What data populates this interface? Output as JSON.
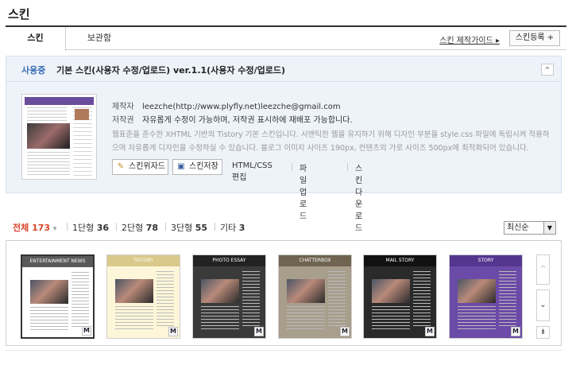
{
  "page": {
    "title": "스킨"
  },
  "tabs": [
    {
      "label": "스킨"
    },
    {
      "label": "보관함"
    }
  ],
  "header_links": {
    "guide": "스킨 제작가이드 ▸",
    "register": "스킨등록 +"
  },
  "current_skin": {
    "badge": "사용중",
    "name": "기본 스킨(사용자 수정/업로드) ver.1.1(사용자 수정/업로드)",
    "author_label": "제작자",
    "author_value": "leezche(http://www.plyfly.net)leezche@gmail.com",
    "license_label": "저작권",
    "license_value": "자유롭게 수정이 가능하며, 저작권 표시하에 재배포 가능합니다.",
    "description_line1": "웹표준을 준수한 XHTML 기반의 Tistory 기본 스킨입니다. 시맨틱한 웹을 유지하기 위해 디자인 부분을 style.css 파일에 독립시켜 적용하였",
    "description_line2": "으며 자유롭게 디자인을 수정하실 수 있습니다. 블로그 이미지 사이즈 190px, 컨텐츠의 가로 사이즈 500px에 최적화되어 있습니다.",
    "collapse_icon": "^"
  },
  "actions": {
    "wizard": "스킨위자드",
    "save": "스킨저장",
    "edit": "HTML/CSS편집",
    "upload": "파일 업로드",
    "download": "스킨 다운로드"
  },
  "filters": [
    {
      "label": "전체",
      "count": "173",
      "caret": "▾"
    },
    {
      "label": "1단형",
      "count": "36"
    },
    {
      "label": "2단형",
      "count": "78"
    },
    {
      "label": "3단형",
      "count": "55"
    },
    {
      "label": "기타",
      "count": "3"
    }
  ],
  "sort": {
    "selected": "최신순",
    "arrow": "▼"
  },
  "thumbnails": [
    {
      "header": "ENTERTAINMENT NEWS",
      "bg": "#ffffff",
      "head_color": "#5a5a5a",
      "badge": "M"
    },
    {
      "header": "TISTORY",
      "bg": "#fdf6d8",
      "head_color": "#d9c98a",
      "badge": "M"
    },
    {
      "header": "PHOTO ESSAY",
      "bg": "#3a3a3a",
      "head_color": "#222222",
      "badge": "M"
    },
    {
      "header": "CHATTERBOX",
      "bg": "#a89e8c",
      "head_color": "#6e6450",
      "badge": "M"
    },
    {
      "header": "MAIL STORY",
      "bg": "#2a2a2a",
      "head_color": "#111111",
      "badge": "M"
    },
    {
      "header": "STORY",
      "bg": "#6c4aa8",
      "head_color": "#55368f",
      "badge": "M"
    }
  ],
  "scroll": {
    "up": "^",
    "down": "⌄",
    "end": "⇟"
  }
}
